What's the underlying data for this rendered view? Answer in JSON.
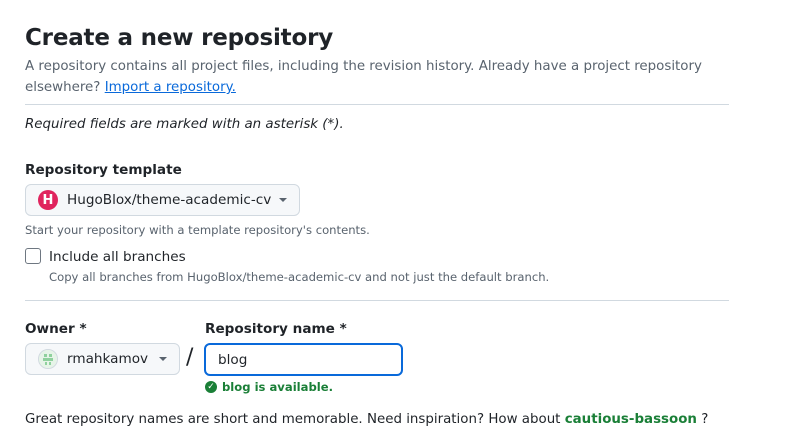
{
  "header": {
    "title": "Create a new repository",
    "intro_text": "A repository contains all project files, including the revision history. Already have a project repository elsewhere?",
    "import_link": "Import a repository."
  },
  "form": {
    "required_note": "Required fields are marked with an asterisk (*).",
    "template": {
      "label": "Repository template",
      "selected": "HugoBlox/theme-academic-cv",
      "logo_letter": "H",
      "helper": "Start your repository with a template repository's contents."
    },
    "include_branches": {
      "label": "Include all branches",
      "checked": false,
      "helper": "Copy all branches from HugoBlox/theme-academic-cv and not just the default branch."
    },
    "owner": {
      "label": "Owner *",
      "selected": "rmahkamov"
    },
    "separator": "/",
    "repo_name": {
      "label": "Repository name *",
      "value": "blog",
      "availability": "blog is available."
    },
    "suggestion": {
      "prefix": "Great repository names are short and memorable. Need inspiration? How about",
      "name": "cautious-bassoon",
      "suffix": "?"
    }
  },
  "icons": {
    "template_logo": "hugoblox-logo-icon",
    "owner_avatar": "identicon-avatar",
    "dropdown": "triangle-down-icon",
    "available": "check-circle-fill-icon"
  },
  "colors": {
    "link": "#0969da",
    "success": "#1a7f37",
    "focus_border": "#0969da",
    "template_logo": "#e0245e"
  }
}
